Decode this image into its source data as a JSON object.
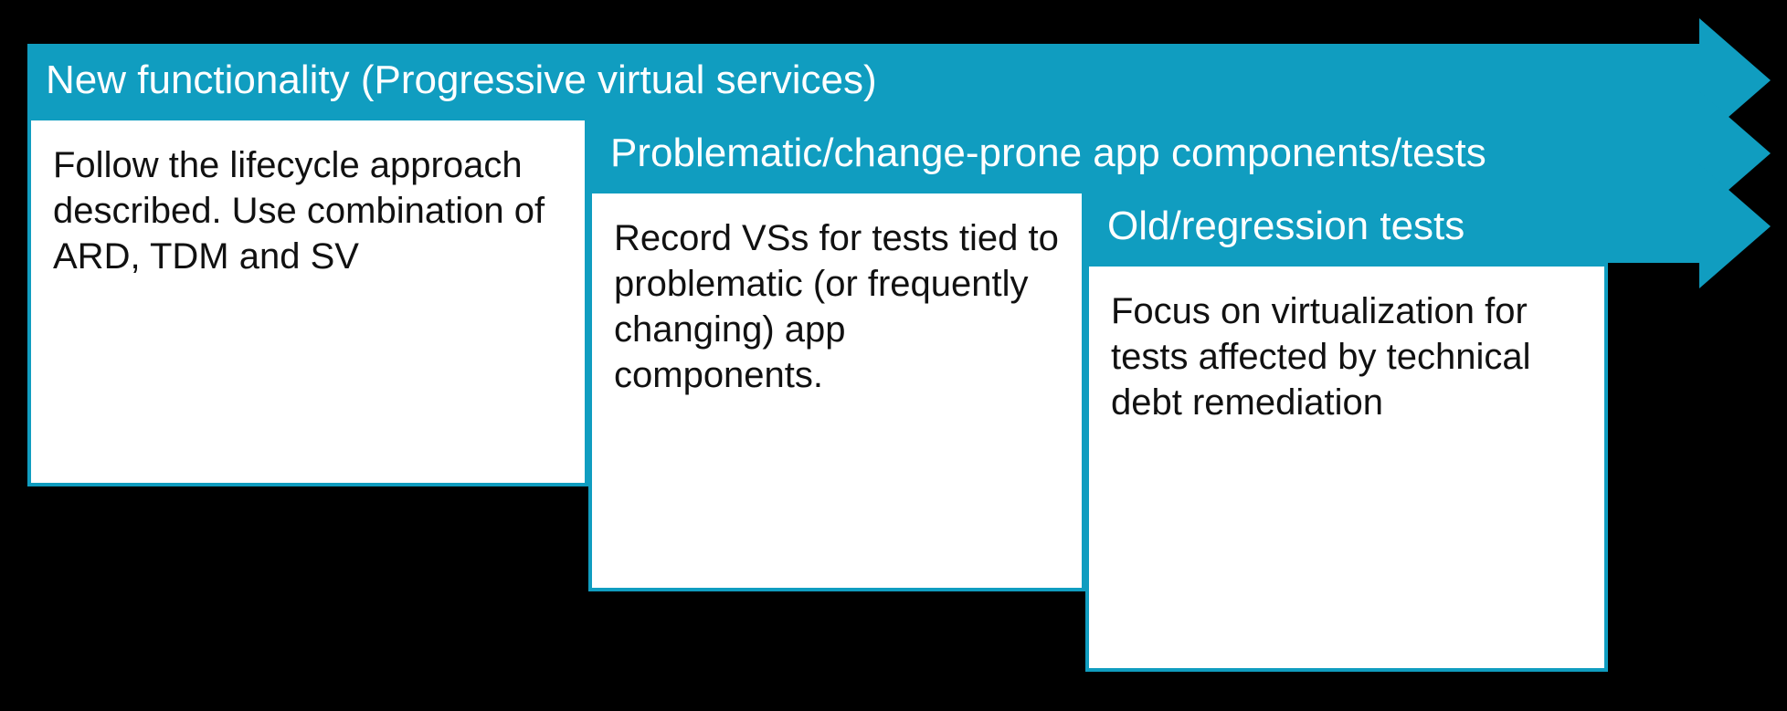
{
  "arrows": [
    {
      "title": "New functionality (Progressive virtual services)",
      "body": "Follow the lifecycle approach described. Use combination of ARD, TDM and SV"
    },
    {
      "title": "Problematic/change-prone app components/tests",
      "body": "Record VSs for tests tied to problematic (or frequently changing) app components."
    },
    {
      "title": "Old/regression tests",
      "body": "Focus on virtualization for tests affected by technical debt remediation"
    }
  ]
}
